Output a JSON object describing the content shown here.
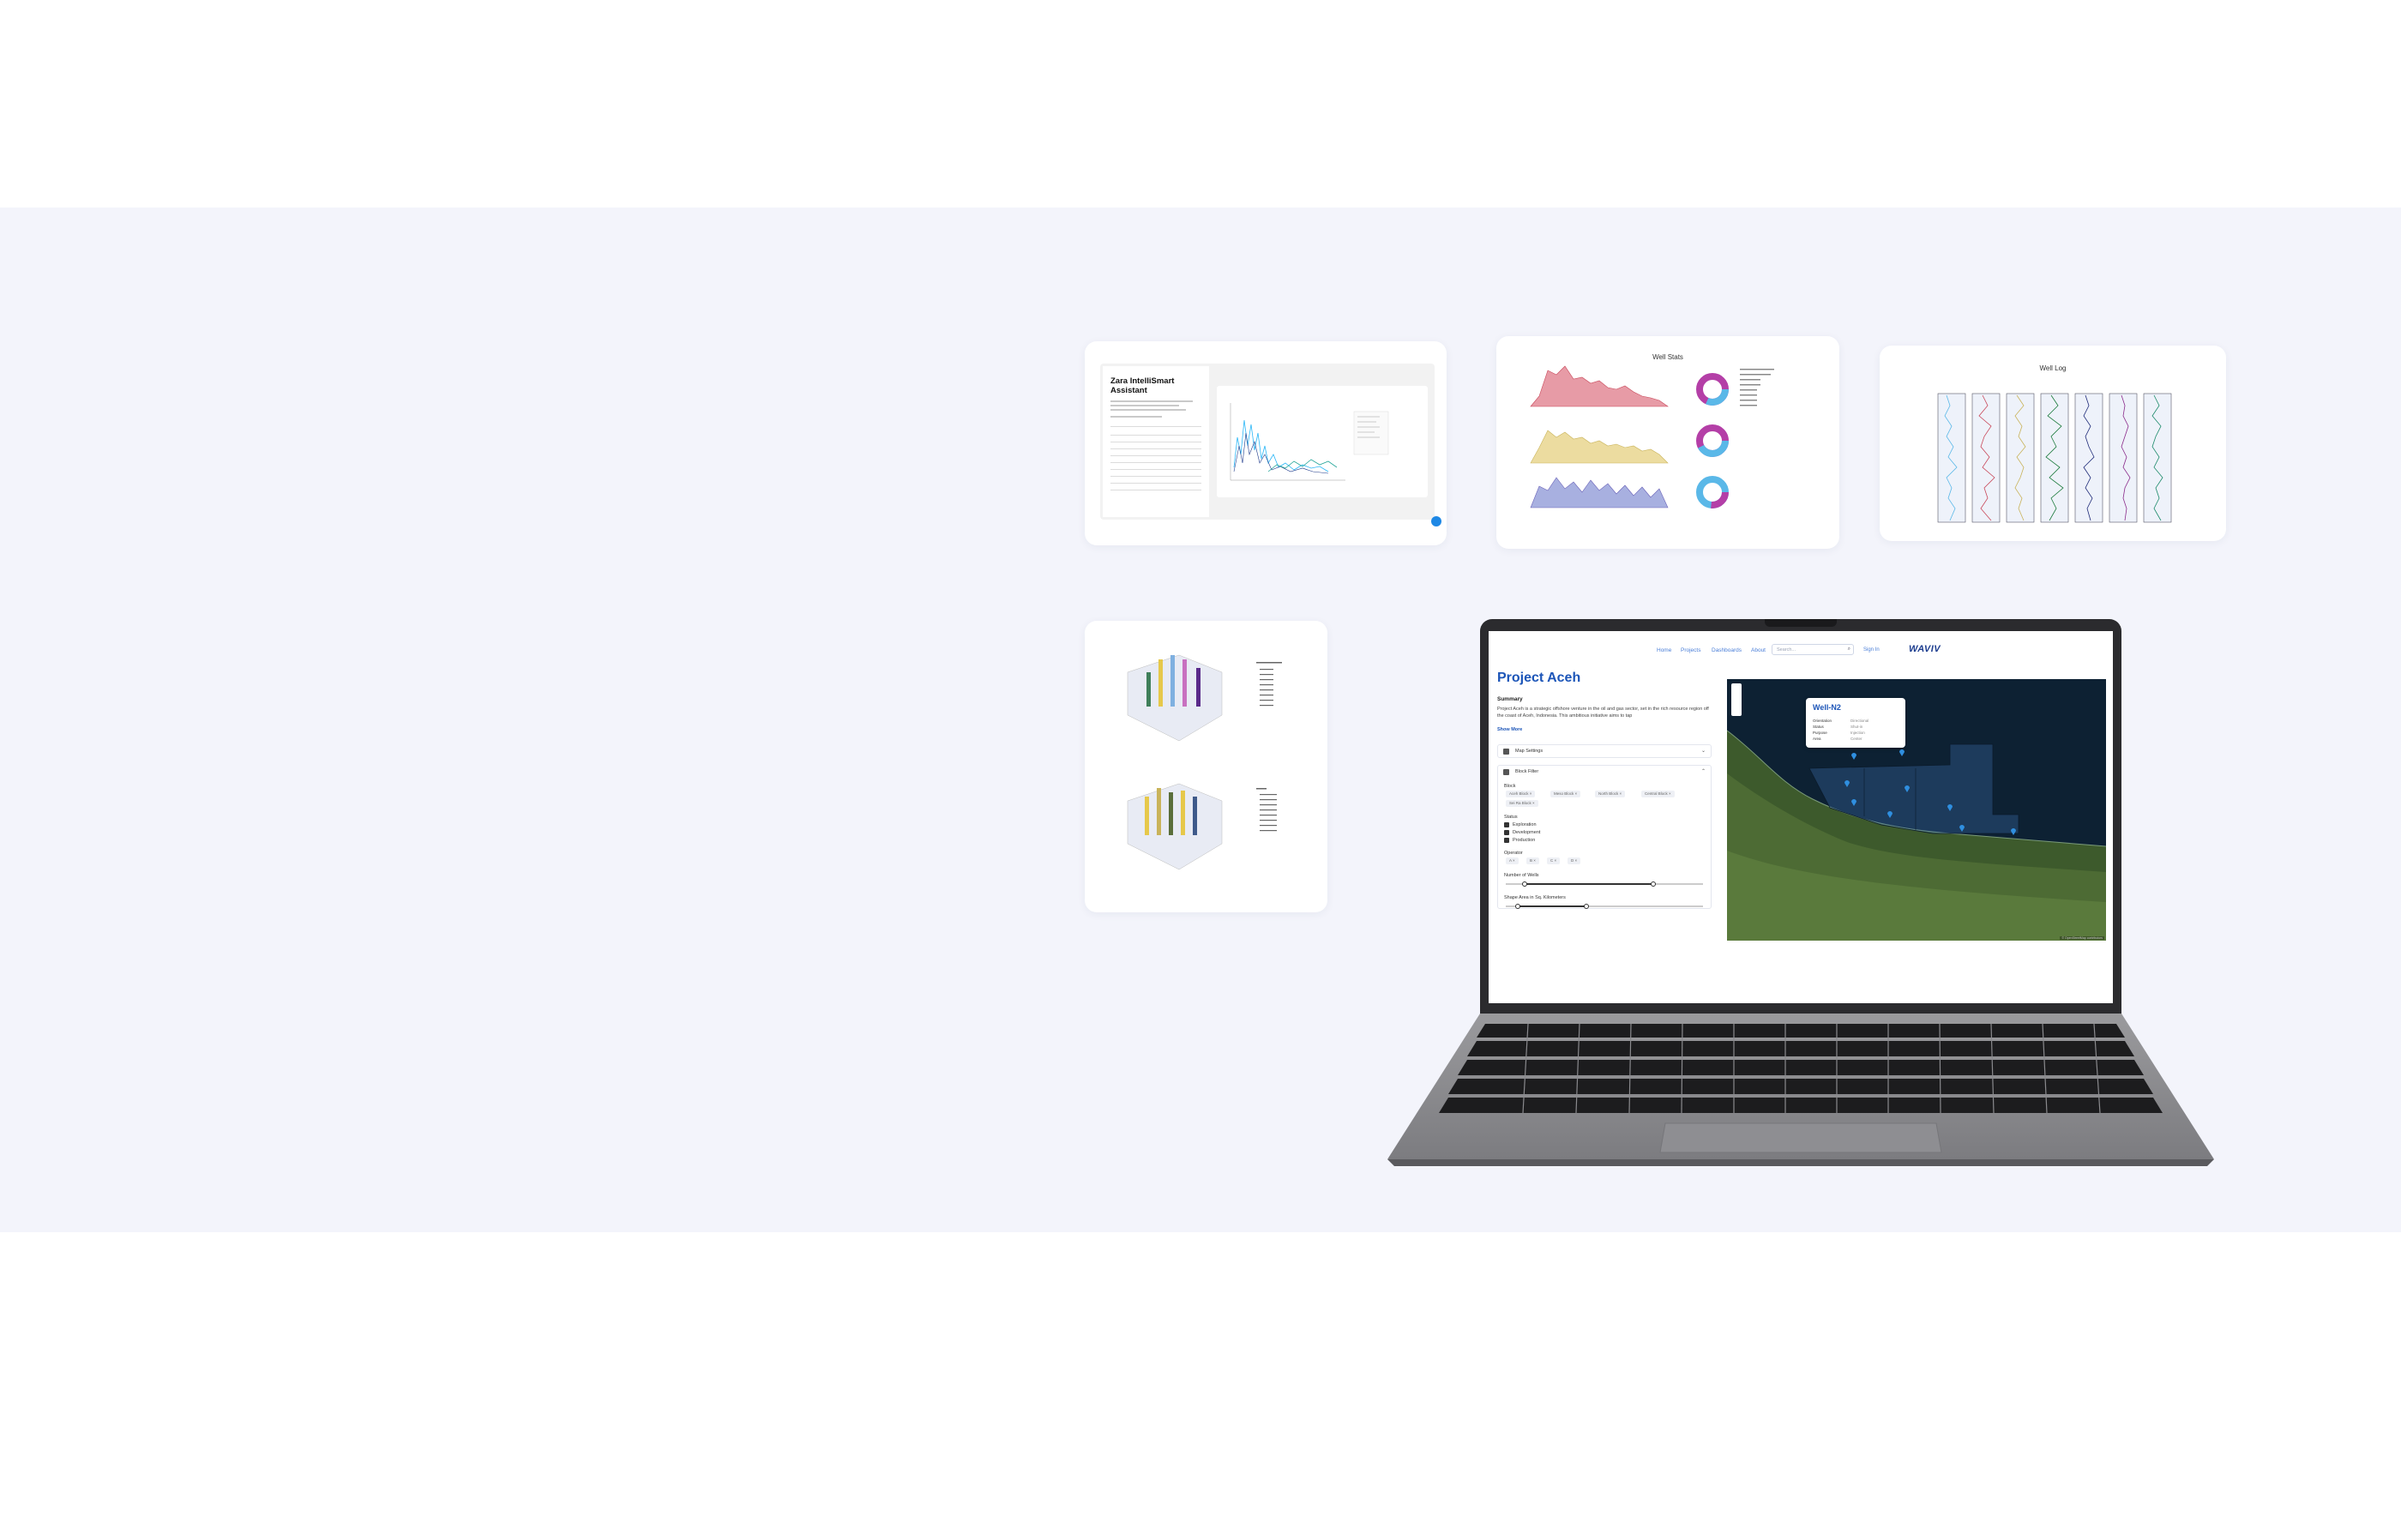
{
  "assistant_card": {
    "title": "Zara IntelliSmart Assistant"
  },
  "wellstats_card": {
    "title": "Well Stats"
  },
  "welllog_card": {
    "title": "Well Log"
  },
  "laptop_app": {
    "nav": {
      "links": [
        "Home",
        "Projects",
        "Dashboards",
        "About"
      ],
      "search_placeholder": "Search...",
      "sign_in": "Sign In",
      "brand": "WAVIV"
    },
    "project_title": "Project Aceh",
    "summary_heading": "Summary",
    "summary_text": "Project Aceh is a strategic offshore venture in the oil and gas sector, set in the rich resource region off the coast of Aceh, Indonesia. This ambitious initiative aims to tap",
    "show_more": "Show More",
    "map_settings": "Map Settings",
    "block_filter": "Block Filter",
    "block_label": "Block",
    "block_chips": [
      "Aceh Block ×",
      "Meso Block ×",
      "North Block ×",
      "Central Block ×",
      "Sei Ra Block ×"
    ],
    "status_label": "Status",
    "statuses": [
      "Exploration",
      "Development",
      "Production"
    ],
    "operator_label": "Operator",
    "operator_chips": [
      "A ×",
      "B ×",
      "C ×",
      "D ×"
    ],
    "wells_label": "Number of Wells",
    "shape_label": "Shape Area in Sq. Kilometers",
    "map_popup": {
      "title": "Well-N2",
      "fields": [
        {
          "key": "Orientation",
          "value": "Directional"
        },
        {
          "key": "Status",
          "value": "Shut-in"
        },
        {
          "key": "Purpose",
          "value": "Injection"
        },
        {
          "key": "Area",
          "value": "Center"
        }
      ]
    },
    "map_attribution": "© OpenStreetMap contributors"
  },
  "colors": {
    "band": "#f3f4fb",
    "accent": "#1c55b8",
    "map_water": "#0d2133",
    "pin": "#2f8fe0"
  }
}
